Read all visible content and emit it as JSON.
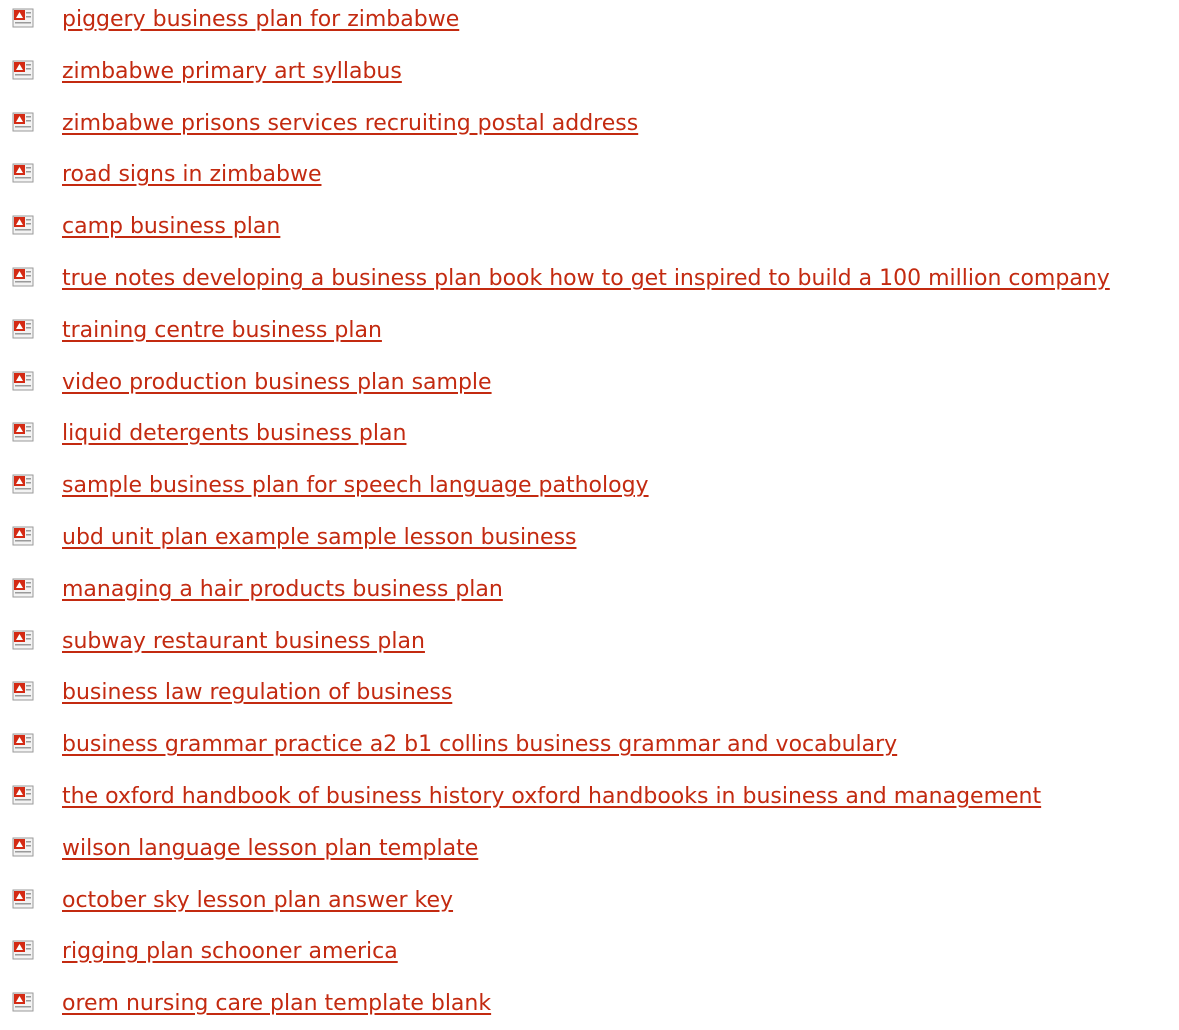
{
  "links": [
    {
      "label": "piggery business plan for zimbabwe",
      "icon": "pdf-file-icon"
    },
    {
      "label": "zimbabwe primary art syllabus",
      "icon": "pdf-file-icon"
    },
    {
      "label": "zimbabwe prisons services recruiting postal address",
      "icon": "pdf-file-icon"
    },
    {
      "label": "road signs in zimbabwe",
      "icon": "pdf-file-icon"
    },
    {
      "label": "camp business plan",
      "icon": "pdf-file-icon"
    },
    {
      "label": "true notes developing a business plan book how to get inspired to build a 100 million company",
      "icon": "pdf-file-icon"
    },
    {
      "label": "training centre business plan",
      "icon": "pdf-file-icon"
    },
    {
      "label": "video production business plan sample",
      "icon": "pdf-file-icon"
    },
    {
      "label": "liquid detergents business plan",
      "icon": "pdf-file-icon"
    },
    {
      "label": "sample business plan for speech language pathology",
      "icon": "pdf-file-icon"
    },
    {
      "label": "ubd unit plan example sample lesson business",
      "icon": "pdf-file-icon"
    },
    {
      "label": "managing a hair products business plan",
      "icon": "pdf-file-icon"
    },
    {
      "label": "subway restaurant business plan",
      "icon": "pdf-file-icon"
    },
    {
      "label": "business law regulation of business",
      "icon": "pdf-file-icon"
    },
    {
      "label": "business grammar practice a2 b1 collins business grammar and vocabulary",
      "icon": "pdf-file-icon"
    },
    {
      "label": "the oxford handbook of business history oxford handbooks in business and management",
      "icon": "pdf-file-icon"
    },
    {
      "label": "wilson language lesson plan template",
      "icon": "pdf-file-icon"
    },
    {
      "label": "october sky lesson plan answer key",
      "icon": "pdf-file-icon"
    },
    {
      "label": "rigging plan schooner america",
      "icon": "pdf-file-icon"
    },
    {
      "label": "orem nursing care plan template blank",
      "icon": "pdf-file-icon"
    }
  ],
  "colors": {
    "link": "#c32a10",
    "icon_red": "#d42a14",
    "icon_page": "#f3f3f3"
  }
}
